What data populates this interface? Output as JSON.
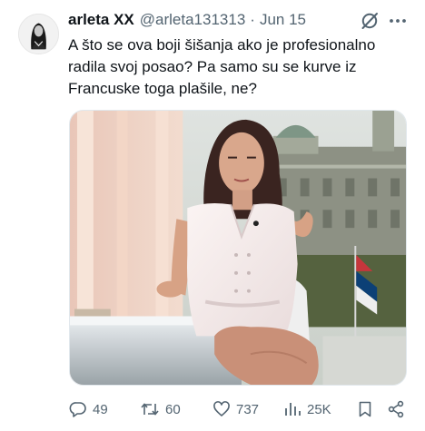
{
  "author": {
    "display_name": "arleta XX",
    "handle": "@arleta131313",
    "separator": "·",
    "date": "Jun 15"
  },
  "tweet": {
    "text": "A što se ova boji šišanja ako je profesionalno radila svoj posao? Pa samo su se kurve iz Francuske toga plašile, ne?"
  },
  "icons": {
    "grok": "grok-slash-icon",
    "more": "more-dots-icon",
    "reply": "reply-bubble-icon",
    "retweet": "retweet-arrows-icon",
    "like": "heart-icon",
    "views": "bar-chart-icon",
    "bookmark": "bookmark-icon",
    "share": "share-icon"
  },
  "actions": {
    "replies": "49",
    "retweets": "60",
    "likes": "737",
    "views": "25K"
  },
  "colors": {
    "text": "#0f1419",
    "secondary": "#536471",
    "border": "#e1e8ed"
  }
}
